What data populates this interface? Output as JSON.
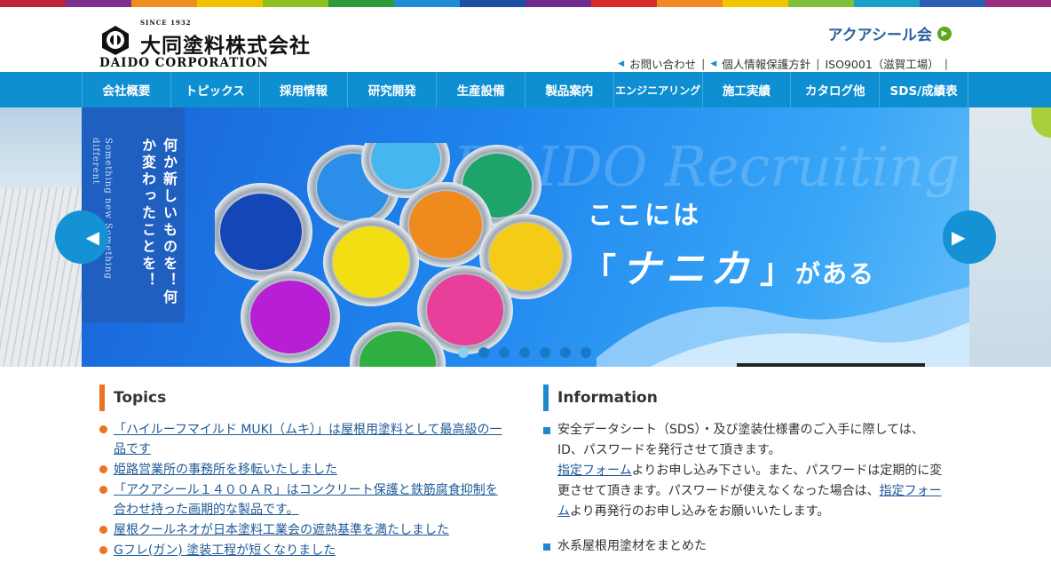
{
  "stripe_colors": [
    "#c0223a",
    "#7b2f8e",
    "#ef8e1d",
    "#f2c200",
    "#8dc21f",
    "#2c9a3a",
    "#1f8dd6",
    "#1b4fa3",
    "#6e2a8c",
    "#d92b2b",
    "#f08a24",
    "#f3c700",
    "#7fbf3a",
    "#1aa1c9",
    "#2b5fb3",
    "#9b2d7f"
  ],
  "header": {
    "since": "SINCE 1932",
    "company_jp": "大同塗料株式会社",
    "company_en": "DAIDO CORPORATION",
    "aqua_link": "アクアシール会",
    "util": {
      "contact": "お問い合わせ",
      "privacy": "個人情報保護方針",
      "iso": "ISO9001（滋賀工場）"
    }
  },
  "nav": {
    "items": [
      "会社概要",
      "トピックス",
      "採用情報",
      "研究開発",
      "生産設備",
      "製品案内",
      "エンジニアリング",
      "施工実績",
      "カタログ他",
      "SDS/成績表"
    ]
  },
  "hero": {
    "vertical_main": "何か新しいものを！何か変わったことを！",
    "vertical_en": "Something new Something different",
    "watermark": "DAIDO Recruiting",
    "catch_line1": "ここには",
    "catch_open": "「",
    "catch_big": "ナニカ",
    "catch_close": "」",
    "catch_tail": "がある",
    "prev_icon": "prev-arrow-icon",
    "next_icon": "next-arrow-icon",
    "dots": 7,
    "active_dot": 0
  },
  "topics": {
    "title": "Topics",
    "accent": "#ec7321",
    "items": [
      "「ハイルーフマイルド MUKI（ムキ）」は屋根用塗料として最高級の一品です",
      "姫路営業所の事務所を移転いたしました",
      "「アクアシール１４００ＡＲ」はコンクリート保護と鉄筋腐食抑制を合わせ持った画期的な製品です。",
      "屋根クールネオが日本塗料工業会の遮熱基準を満たしました",
      "Gフレ(ガン)  塗装工程が短くなりました"
    ]
  },
  "information": {
    "title": "Information",
    "accent": "#1d8ad0",
    "item1": {
      "line1": "安全データシート（SDS）・及び塗装仕様書のご入手に際しては、",
      "line2": "ID、パスワードを発行させて頂きます。",
      "link1": "指定フォーム",
      "text3": "よりお申し込み下さい。また、パスワードは定期的に変更させて頂きます。パスワードが使えなくなった場合は、",
      "link2": "指定フォーム",
      "text4": "より再発行のお申し込みをお願いいたします。"
    },
    "item2": "水系屋根用塗材をまとめた"
  }
}
